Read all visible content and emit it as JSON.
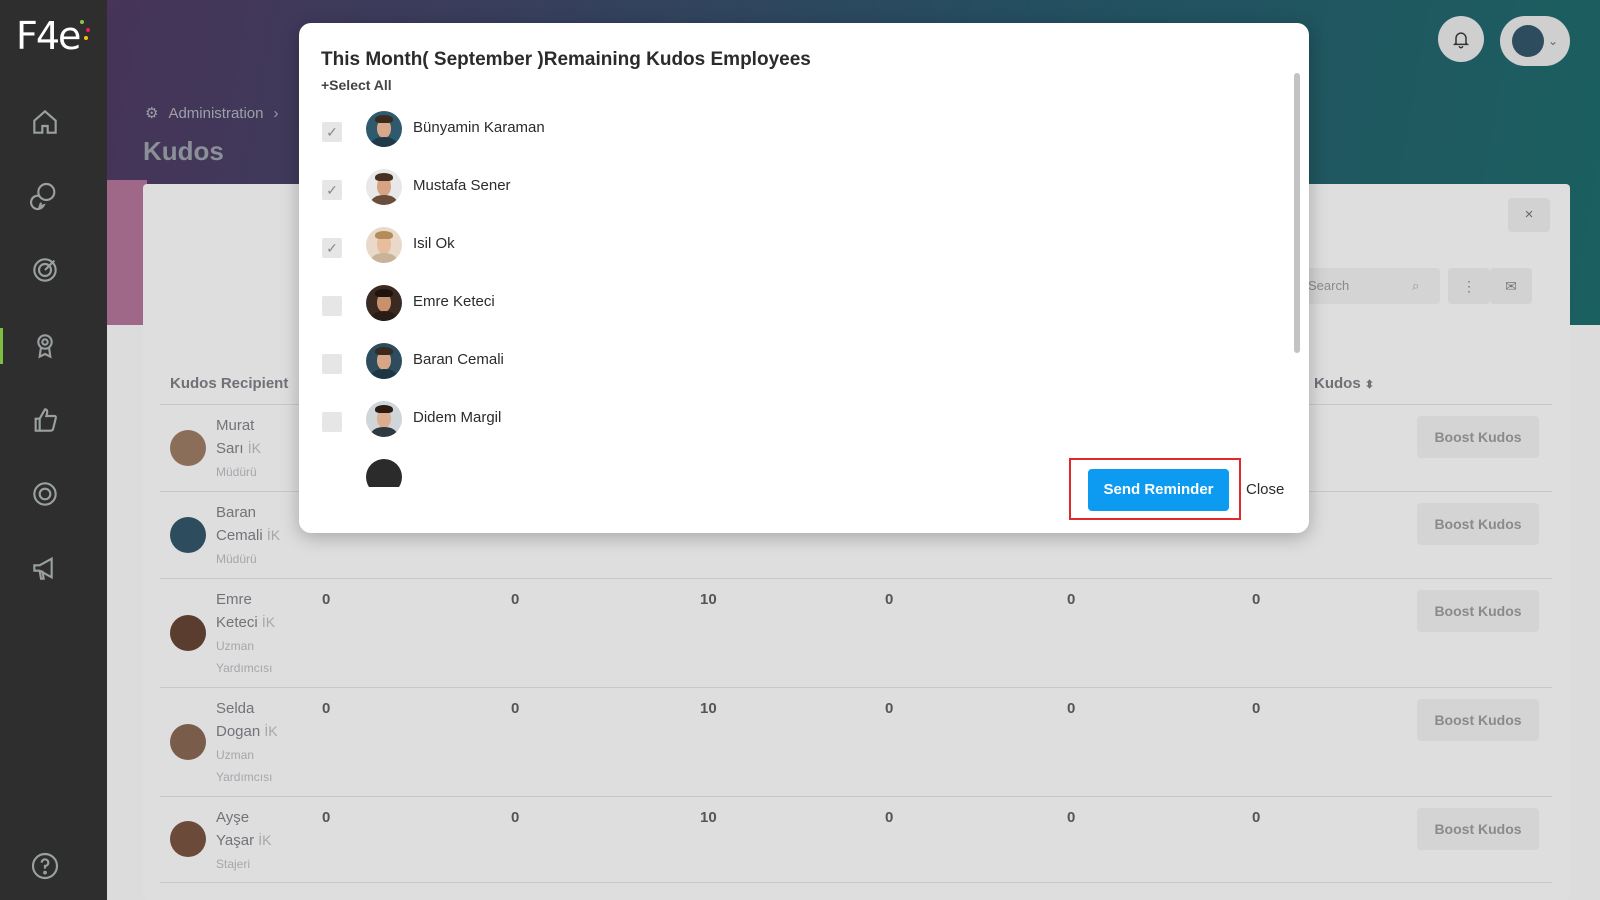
{
  "app": {
    "logo": "F4e"
  },
  "header": {
    "breadcrumb_root": "Administration",
    "page_title": "Kudos"
  },
  "table": {
    "search_placeholder": "Search",
    "col_recipient": "Kudos Recipient",
    "col_kudos": "Kudos",
    "rows": [
      {
        "first": "Murat",
        "last": "Sarı",
        "dept": "İK",
        "role": "Müdürü",
        "values": [
          "",
          "",
          "",
          "",
          "",
          ""
        ],
        "boost": "Boost Kudos"
      },
      {
        "first": "Baran",
        "last": "Cemali",
        "dept": "İK",
        "role": "Müdürü",
        "values": [
          "",
          "",
          "",
          "",
          "",
          ""
        ],
        "boost": "Boost Kudos"
      },
      {
        "first": "Emre",
        "last": "Keteci",
        "dept": "İK",
        "role": "Uzman Yardımcısı",
        "values": [
          "0",
          "0",
          "10",
          "0",
          "0",
          "0"
        ],
        "boost": "Boost Kudos"
      },
      {
        "first": "Selda",
        "last": "Dogan",
        "dept": "İK",
        "role": "Uzman Yardımcısı",
        "values": [
          "0",
          "0",
          "10",
          "0",
          "0",
          "0"
        ],
        "boost": "Boost Kudos"
      },
      {
        "first": "Ayşe",
        "last": "Yaşar",
        "dept": "İK",
        "role": "Stajeri",
        "values": [
          "0",
          "0",
          "10",
          "0",
          "0",
          "0"
        ],
        "boost": "Boost Kudos"
      }
    ]
  },
  "modal": {
    "title": "This Month( September )Remaining Kudos Employees",
    "select_all": "+Select All",
    "employees": [
      {
        "name": "Bünyamin Karaman",
        "checked": true
      },
      {
        "name": "Mustafa Sener",
        "checked": true
      },
      {
        "name": "Isil Ok",
        "checked": true
      },
      {
        "name": "Emre Keteci",
        "checked": false
      },
      {
        "name": "Baran Cemali",
        "checked": false
      },
      {
        "name": "Didem Margil",
        "checked": false
      }
    ],
    "send_label": "Send Reminder",
    "close_label": "Close"
  },
  "colors": {
    "accent": "#0d9bf2",
    "highlight": "#e0282e",
    "sidebar": "#2e2e2e"
  }
}
